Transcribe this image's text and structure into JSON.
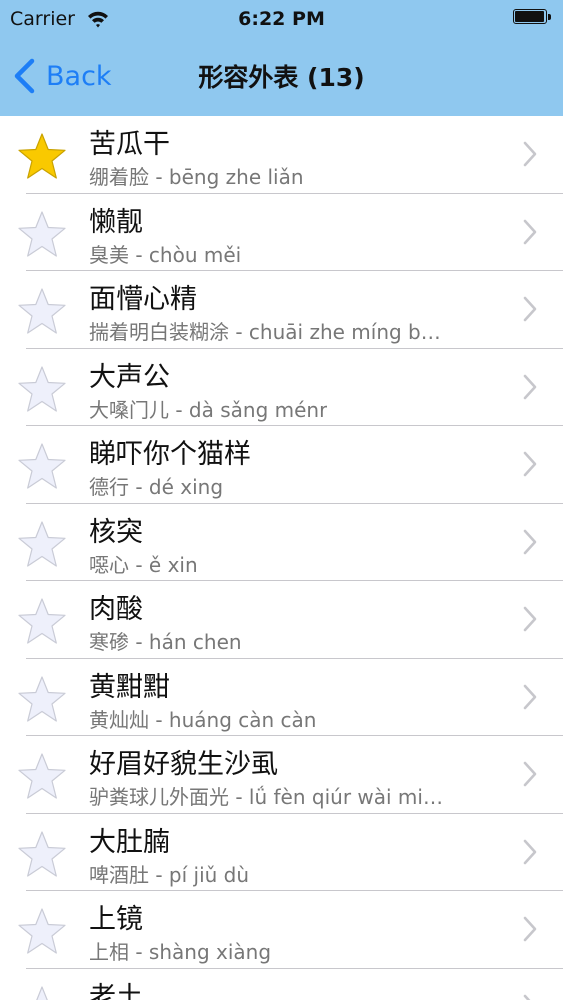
{
  "status_bar": {
    "carrier": "Carrier",
    "time": "6:22 PM"
  },
  "nav": {
    "back_label": "Back",
    "title": "形容外表 (13)"
  },
  "colors": {
    "header_bg": "#8fc8ef",
    "accent": "#1d7ef6",
    "star_on": "#f9c900",
    "star_off": "#eef0fb"
  },
  "items": [
    {
      "title": "苦瓜干",
      "subtitle": "绷着脸 - bēng zhe liǎn",
      "favorite": true
    },
    {
      "title": "懒靓",
      "subtitle": "臭美 - chòu měi",
      "favorite": false
    },
    {
      "title": "面懵心精",
      "subtitle": "揣着明白装糊涂 - chuāi zhe míng b…",
      "favorite": false
    },
    {
      "title": "大声公",
      "subtitle": "大嗓门儿 - dà sǎng ménr",
      "favorite": false
    },
    {
      "title": "睇吓你个猫样",
      "subtitle": "德行 - dé xing",
      "favorite": false
    },
    {
      "title": "核突",
      "subtitle": "噁心 - ě xin",
      "favorite": false
    },
    {
      "title": "肉酸",
      "subtitle": "寒碜 - hán chen",
      "favorite": false
    },
    {
      "title": "黄黚黚",
      "subtitle": "黄灿灿 - huáng càn càn",
      "favorite": false
    },
    {
      "title": "好眉好貌生沙虱",
      "subtitle": "驴粪球儿外面光 - lǘ fèn qiúr wài mi…",
      "favorite": false
    },
    {
      "title": "大肚腩",
      "subtitle": "啤酒肚 - pí jiǔ dù",
      "favorite": false
    },
    {
      "title": "上镜",
      "subtitle": "上相 - shàng xiàng",
      "favorite": false
    },
    {
      "title": "老土",
      "subtitle": "",
      "favorite": false
    }
  ]
}
